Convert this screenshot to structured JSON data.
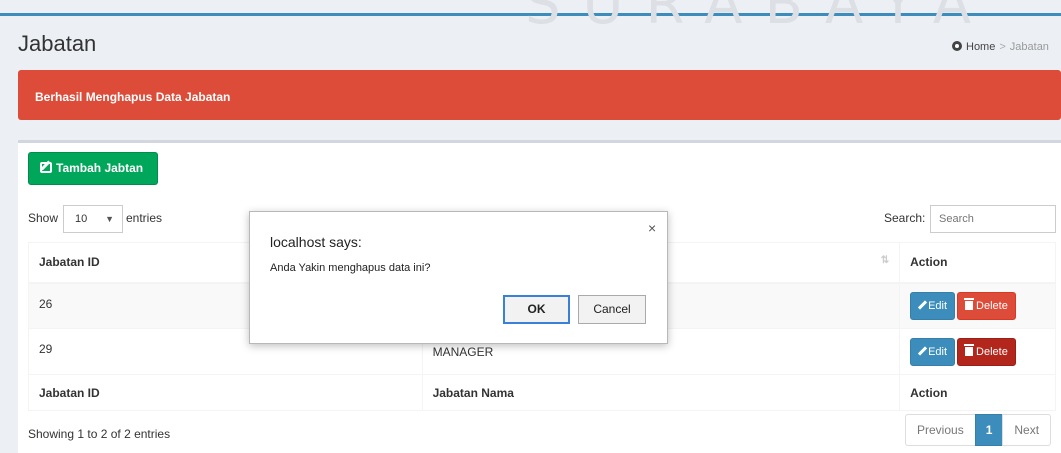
{
  "watermark": "SURABAYA",
  "header": {
    "title": "Jabatan",
    "breadcrumb": [
      "Home",
      "Jabatan"
    ]
  },
  "alert": {
    "text": "Berhasil Menghapus Data Jabatan"
  },
  "toolbar": {
    "add_label": "Tambah Jabtan"
  },
  "table_controls": {
    "show_label": "Show",
    "page_length": "10",
    "entries_label": "entries",
    "search_label": "Search:",
    "search_placeholder": "Search"
  },
  "table": {
    "columns": [
      "Jabatan ID",
      "Jabatan Nama",
      "Action"
    ],
    "rows": [
      {
        "id": "26",
        "nama": ""
      },
      {
        "id": "29",
        "nama": "MANAGER"
      }
    ],
    "edit_label": "Edit",
    "delete_label": "Delete"
  },
  "footer": {
    "info": "Showing 1 to 2 of 2 entries",
    "pagination": {
      "previous": "Previous",
      "current": "1",
      "next": "Next"
    }
  },
  "dialog": {
    "title": "localhost says:",
    "message": "Anda Yakin menghapus data ini?",
    "ok_label": "OK",
    "cancel_label": "Cancel",
    "close_glyph": "×"
  },
  "colors": {
    "alert": "#dd4b39",
    "success": "#00a65a",
    "primary": "#3c8dbc",
    "danger": "#dd4b39"
  }
}
